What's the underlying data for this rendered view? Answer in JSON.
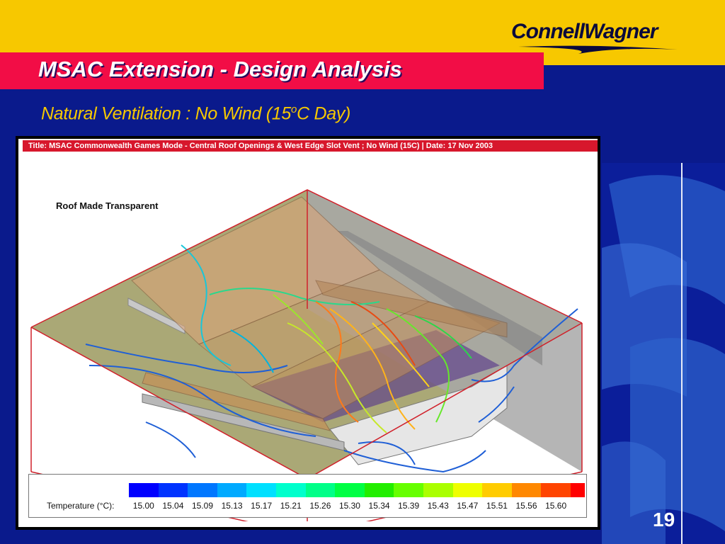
{
  "header": {
    "logo_text": "ConnellWagner",
    "colors": {
      "band": "#f7c800",
      "title_bar": "#f20d46",
      "background": "#0a1a8c"
    }
  },
  "slide": {
    "title": "MSAC Extension - Design Analysis",
    "subtitle_pre": "Natural Ventilation : No Wind (15",
    "subtitle_sup": "o",
    "subtitle_post": "C Day)",
    "page_number": "19"
  },
  "figure": {
    "title_bar": "Title: MSAC Commonwealth Games Mode - Central Roof Openings & West Edge Slot Vent ; No Wind (15C)   |   Date: 17 Nov 2003",
    "annotation": "Roof Made Transparent"
  },
  "legend": {
    "label": "Temperature (°C):",
    "values": [
      "15.00",
      "15.04",
      "15.09",
      "15.13",
      "15.17",
      "15.21",
      "15.26",
      "15.30",
      "15.34",
      "15.39",
      "15.43",
      "15.47",
      "15.51",
      "15.56",
      "15.60"
    ],
    "colors": [
      "#0000ff",
      "#0033ff",
      "#0077ff",
      "#00aaff",
      "#00e0ff",
      "#00ffcc",
      "#00ff88",
      "#00ff44",
      "#22ee00",
      "#66ff00",
      "#aaff00",
      "#eeff00",
      "#ffcc00",
      "#ff8800",
      "#ff4400",
      "#ff0000"
    ]
  }
}
